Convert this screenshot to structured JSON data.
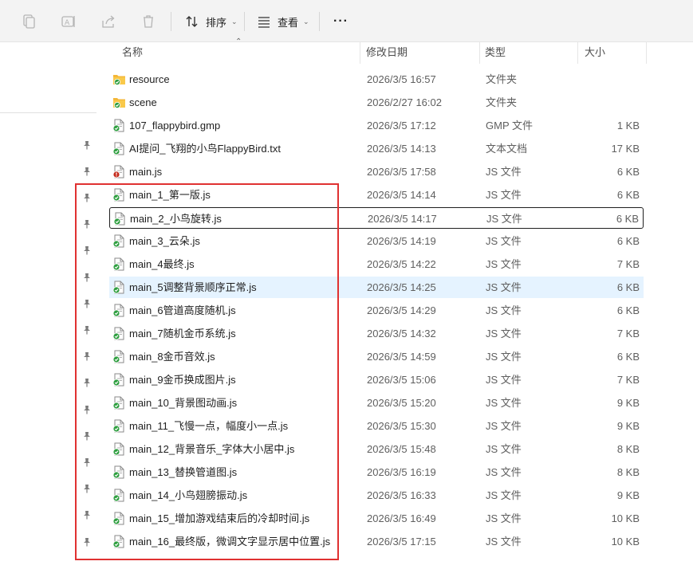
{
  "toolbar": {
    "copy_icon": "copy-icon",
    "rename_icon": "rename-icon",
    "share_icon": "share-icon",
    "delete_icon": "delete-icon",
    "sort_label": "排序",
    "view_label": "查看",
    "more_label": "···"
  },
  "columns": {
    "name": "名称",
    "date": "修改日期",
    "type": "类型",
    "size": "大小"
  },
  "files": [
    {
      "name": "resource",
      "date": "2026/3/5 16:57",
      "type": "文件夹",
      "size": "",
      "icon": "folder"
    },
    {
      "name": "scene",
      "date": "2026/2/27 16:02",
      "type": "文件夹",
      "size": "",
      "icon": "folder"
    },
    {
      "name": "107_flappybird.gmp",
      "date": "2026/3/5 17:12",
      "type": "GMP 文件",
      "size": "1 KB",
      "icon": "doc"
    },
    {
      "name": "AI提问_飞翔的小鸟FlappyBird.txt",
      "date": "2026/3/5 14:13",
      "type": "文本文档",
      "size": "17 KB",
      "icon": "doc"
    },
    {
      "name": "main.js",
      "date": "2026/3/5 17:58",
      "type": "JS 文件",
      "size": "6 KB",
      "icon": "doc-error"
    },
    {
      "name": "main_1_第一版.js",
      "date": "2026/3/5 14:14",
      "type": "JS 文件",
      "size": "6 KB",
      "icon": "doc"
    },
    {
      "name": "main_2_小鸟旋转.js",
      "date": "2026/3/5 14:17",
      "type": "JS 文件",
      "size": "6 KB",
      "icon": "doc"
    },
    {
      "name": "main_3_云朵.js",
      "date": "2026/3/5 14:19",
      "type": "JS 文件",
      "size": "6 KB",
      "icon": "doc"
    },
    {
      "name": "main_4最终.js",
      "date": "2026/3/5 14:22",
      "type": "JS 文件",
      "size": "7 KB",
      "icon": "doc"
    },
    {
      "name": "main_5调整背景顺序正常.js",
      "date": "2026/3/5 14:25",
      "type": "JS 文件",
      "size": "6 KB",
      "icon": "doc"
    },
    {
      "name": "main_6管道高度随机.js",
      "date": "2026/3/5 14:29",
      "type": "JS 文件",
      "size": "6 KB",
      "icon": "doc"
    },
    {
      "name": "main_7随机金币系统.js",
      "date": "2026/3/5 14:32",
      "type": "JS 文件",
      "size": "7 KB",
      "icon": "doc"
    },
    {
      "name": "main_8金币音效.js",
      "date": "2026/3/5 14:59",
      "type": "JS 文件",
      "size": "6 KB",
      "icon": "doc"
    },
    {
      "name": "main_9金币换成图片.js",
      "date": "2026/3/5 15:06",
      "type": "JS 文件",
      "size": "7 KB",
      "icon": "doc"
    },
    {
      "name": "main_10_背景图动画.js",
      "date": "2026/3/5 15:20",
      "type": "JS 文件",
      "size": "9 KB",
      "icon": "doc"
    },
    {
      "name": "main_11_飞慢一点，幅度小一点.js",
      "date": "2026/3/5 15:30",
      "type": "JS 文件",
      "size": "9 KB",
      "icon": "doc"
    },
    {
      "name": "main_12_背景音乐_字体大小居中.js",
      "date": "2026/3/5 15:48",
      "type": "JS 文件",
      "size": "8 KB",
      "icon": "doc"
    },
    {
      "name": "main_13_替换管道图.js",
      "date": "2026/3/5 16:19",
      "type": "JS 文件",
      "size": "8 KB",
      "icon": "doc"
    },
    {
      "name": "main_14_小鸟翅膀振动.js",
      "date": "2026/3/5 16:33",
      "type": "JS 文件",
      "size": "9 KB",
      "icon": "doc"
    },
    {
      "name": "main_15_增加游戏结束后的冷却时间.js",
      "date": "2026/3/5 16:49",
      "type": "JS 文件",
      "size": "10 KB",
      "icon": "doc"
    },
    {
      "name": "main_16_最终版，微调文字显示居中位置.js",
      "date": "2026/3/5 17:15",
      "type": "JS 文件",
      "size": "10 KB",
      "icon": "doc"
    }
  ],
  "colors": {
    "annotation": "#e03131",
    "hover": "#e5f3ff",
    "sync_green": "#2e9e3f",
    "folder": "#f4b738",
    "error_red": "#c42b1c"
  }
}
